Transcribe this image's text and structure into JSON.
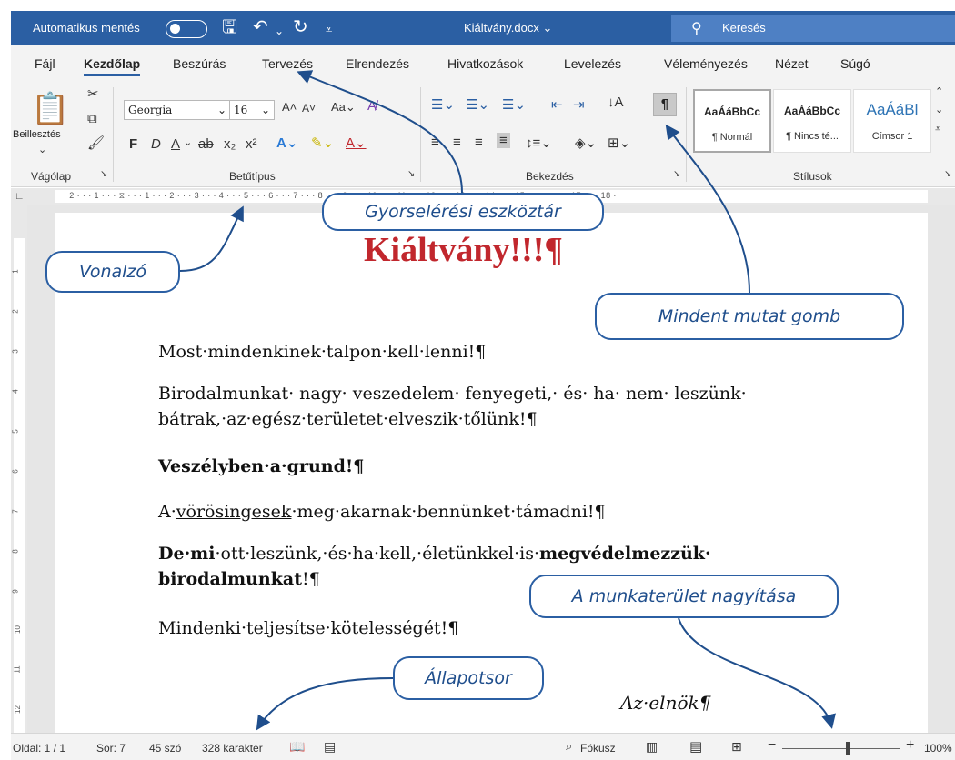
{
  "titlebar": {
    "autosave_label": "Automatikus mentés",
    "doc_name": "Kiáltvány.docx",
    "doc_name_caret": "⌄",
    "search_placeholder": "Keresés"
  },
  "tabs": [
    "Fájl",
    "Kezdőlap",
    "Beszúrás",
    "Tervezés",
    "Elrendezés",
    "Hivatkozások",
    "Levelezés",
    "Véleményezés",
    "Nézet",
    "Súgó"
  ],
  "active_tab": "Kezdőlap",
  "ribbon": {
    "paste_label": "Beillesztés",
    "font_name": "Georgia",
    "font_size": "16",
    "groups": {
      "clipboard": "Vágólap",
      "font": "Betűtípus",
      "paragraph": "Bekezdés",
      "styles": "Stílusok"
    },
    "styles": [
      {
        "preview": "AaÁáBbCc",
        "name": "¶ Normál"
      },
      {
        "preview": "AaÁáBbCc",
        "name": "¶ Nincs té..."
      },
      {
        "preview": "AaÁáBl",
        "name": "Címsor 1"
      }
    ]
  },
  "document": {
    "title": "Kiáltvány!!!¶",
    "p1": "Most·mindenkinek·talpon·kell·lenni!¶",
    "p2_line1": "Birodalmunkat· nagy· veszedelem· fenyegeti,· és· ha· nem· leszünk·",
    "p2_line2": "bátrak,·az·egész·területet·elveszik·tőlünk!¶",
    "p3": "Veszélyben·a·grund!¶",
    "p4_pre": "A·",
    "p4_underlined": "vörösingesek",
    "p4_post": "·meg·akarnak·bennünket·támadni!¶",
    "p5_bold1": "De·mi",
    "p5_mid": "·ott·leszünk,·és·ha·kell,·életünkkel·is·",
    "p5_bold2": "megvédelmezzük·",
    "p5_line2_bold": "birodalmunkat",
    "p5_line2_end": "!¶",
    "p6": "Mindenki·teljesítse·kötelességét!¶",
    "signature": "Az·elnök¶"
  },
  "statusbar": {
    "page": "Oldal: 1 / 1",
    "line": "Sor: 7",
    "words": "45 szó",
    "chars": "328 karakter",
    "focus": "Fókusz",
    "zoom_minus": "−",
    "zoom_plus": "+",
    "zoom": "100%"
  },
  "callouts": {
    "quick_access": "Gyorselérési eszköztár",
    "ruler": "Vonalzó",
    "show_all": "Mindent mutat gomb",
    "zoom": "A munkaterület nagyítása",
    "statusbar": "Állapotsor"
  },
  "colors": {
    "title_bar": "#2b5fa3",
    "doc_title": "#c1272d",
    "callout": "#1f4e8c"
  }
}
